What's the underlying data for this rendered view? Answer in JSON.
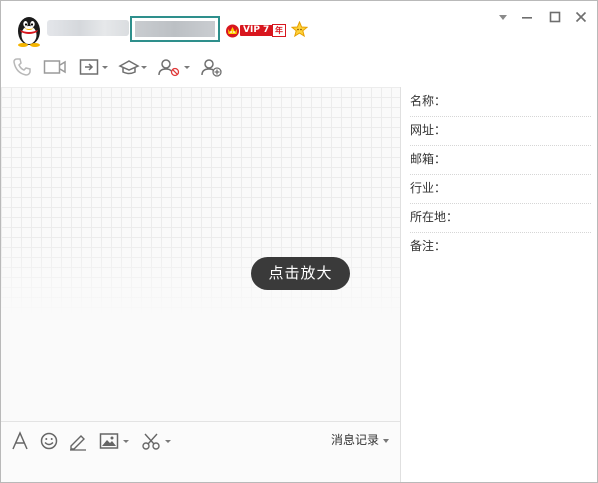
{
  "header": {
    "vip_text": "VIP 7",
    "vip_year": "年"
  },
  "chat": {
    "zoom_hint": "点击放大"
  },
  "input_bar": {
    "history_label": "消息记录"
  },
  "profile": {
    "fields": [
      {
        "label": "名称：",
        "value": ""
      },
      {
        "label": "网址：",
        "value": ""
      },
      {
        "label": "邮箱：",
        "value": ""
      },
      {
        "label": "行业：",
        "value": ""
      },
      {
        "label": "所在地：",
        "value": ""
      },
      {
        "label": "备注：",
        "value": ""
      }
    ]
  },
  "colors": {
    "accent_box": "#2e8f8c",
    "vip_red": "#d8161e",
    "hint_bg": "#3a3a3a"
  },
  "icons": {
    "toolbar": [
      "phone-icon",
      "video-call-icon",
      "share-screen-icon",
      "app-hat-icon",
      "block-user-icon",
      "add-contact-icon"
    ],
    "input_bar": [
      "font-icon",
      "emoji-icon",
      "pen-icon",
      "image-icon",
      "screenshot-scissors-icon"
    ],
    "window": [
      "dropdown-arrow-icon",
      "minimize-icon",
      "maximize-icon",
      "close-icon"
    ]
  }
}
